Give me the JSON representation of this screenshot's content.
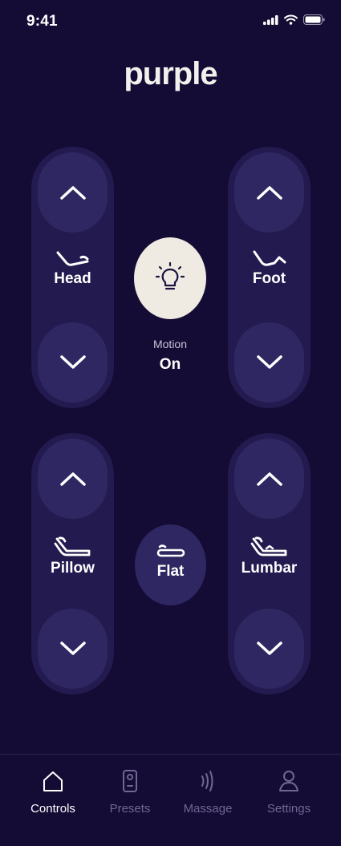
{
  "status_bar": {
    "time": "9:41"
  },
  "brand": {
    "logo_text": "purple"
  },
  "controls": {
    "head": {
      "label": "Head"
    },
    "foot": {
      "label": "Foot"
    },
    "pillow": {
      "label": "Pillow"
    },
    "lumbar": {
      "label": "Lumbar"
    },
    "motion": {
      "title": "Motion",
      "value": "On"
    },
    "flat": {
      "label": "Flat"
    }
  },
  "tabs": [
    {
      "label": "Controls",
      "icon": "home-icon",
      "active": true
    },
    {
      "label": "Presets",
      "icon": "remote-icon",
      "active": false
    },
    {
      "label": "Massage",
      "icon": "vibration-icon",
      "active": false
    },
    {
      "label": "Settings",
      "icon": "person-icon",
      "active": false
    }
  ],
  "colors": {
    "background": "#140c35",
    "pill": "#231a4f",
    "button": "#2f2762",
    "motion_button": "#efebe3",
    "inactive_tab": "#6f6894"
  }
}
